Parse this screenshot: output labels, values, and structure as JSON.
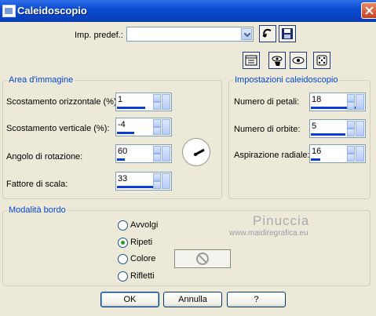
{
  "window": {
    "title": "Caleidoscopio"
  },
  "preset": {
    "label": "Imp. predef.:",
    "value": ""
  },
  "image_area": {
    "legend": "Area d'immagine",
    "fields": [
      {
        "label": "Scostamento orizzontale (%):",
        "value": "1"
      },
      {
        "label": "Scostamento verticale (%):",
        "value": "-4"
      },
      {
        "label": "Angolo di rotazione:",
        "value": "60"
      },
      {
        "label": "Fattore di scala:",
        "value": "33"
      }
    ]
  },
  "kaleido_settings": {
    "legend": "Impostazioni caleidoscopio",
    "fields": [
      {
        "label": "Numero di petali:",
        "value": "18"
      },
      {
        "label": "Numero di orbite:",
        "value": "5"
      },
      {
        "label": "Aspirazione radiale:",
        "value": "16"
      }
    ]
  },
  "border_mode": {
    "legend": "Modalità bordo",
    "options": [
      {
        "label": "Avvolgi",
        "checked": false
      },
      {
        "label": "Ripeti",
        "checked": true
      },
      {
        "label": "Colore",
        "checked": false
      },
      {
        "label": "Rifletti",
        "checked": false
      }
    ]
  },
  "watermark": {
    "name": "Pinuccia",
    "url": "www.maidiregrafica.eu"
  },
  "buttons": {
    "ok": "OK",
    "cancel": "Annulla",
    "help": "?"
  },
  "colors": {
    "accent": "#0046d5",
    "title_bar": "#0a4bd2",
    "spin_bar": "#0a3ed4"
  }
}
